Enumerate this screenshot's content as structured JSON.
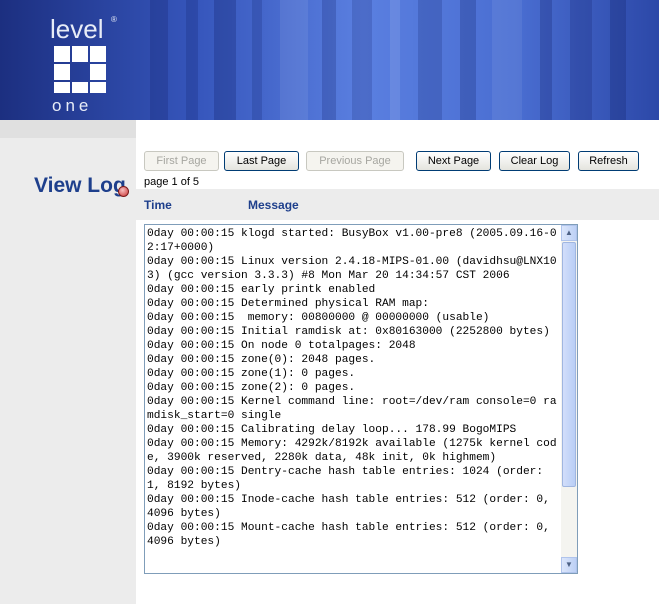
{
  "brand": {
    "logo_top": "level",
    "logo_bottom": "one",
    "logo_mark": "®"
  },
  "colors": {
    "banner": "#3656bc",
    "title": "#1e3f8c",
    "sidebar": "#ececec"
  },
  "page": {
    "title": "View Log",
    "page_indicator": "page 1 of 5"
  },
  "toolbar": {
    "first_page": "First Page",
    "last_page": "Last Page",
    "previous_page": "Previous Page",
    "next_page": "Next Page",
    "clear_log": "Clear Log",
    "refresh": "Refresh"
  },
  "table": {
    "col_time": "Time",
    "col_message": "Message"
  },
  "log": {
    "text": "0day 00:00:15 klogd started: BusyBox v1.00-pre8 (2005.09.16-02:17+0000)\n0day 00:00:15 Linux version 2.4.18-MIPS-01.00 (davidhsu@LNX103) (gcc version 3.3.3) #8 Mon Mar 20 14:34:57 CST 2006\n0day 00:00:15 early printk enabled\n0day 00:00:15 Determined physical RAM map:\n0day 00:00:15  memory: 00800000 @ 00000000 (usable)\n0day 00:00:15 Initial ramdisk at: 0x80163000 (2252800 bytes)\n0day 00:00:15 On node 0 totalpages: 2048\n0day 00:00:15 zone(0): 2048 pages.\n0day 00:00:15 zone(1): 0 pages.\n0day 00:00:15 zone(2): 0 pages.\n0day 00:00:15 Kernel command line: root=/dev/ram console=0 ramdisk_start=0 single\n0day 00:00:15 Calibrating delay loop... 178.99 BogoMIPS\n0day 00:00:15 Memory: 4292k/8192k available (1275k kernel code, 3900k reserved, 2280k data, 48k init, 0k highmem)\n0day 00:00:15 Dentry-cache hash table entries: 1024 (order: 1, 8192 bytes)\n0day 00:00:15 Inode-cache hash table entries: 512 (order: 0, 4096 bytes)\n0day 00:00:15 Mount-cache hash table entries: 512 (order: 0, 4096 bytes)"
  },
  "scrollbar": {
    "up_glyph": "▲",
    "down_glyph": "▼"
  }
}
